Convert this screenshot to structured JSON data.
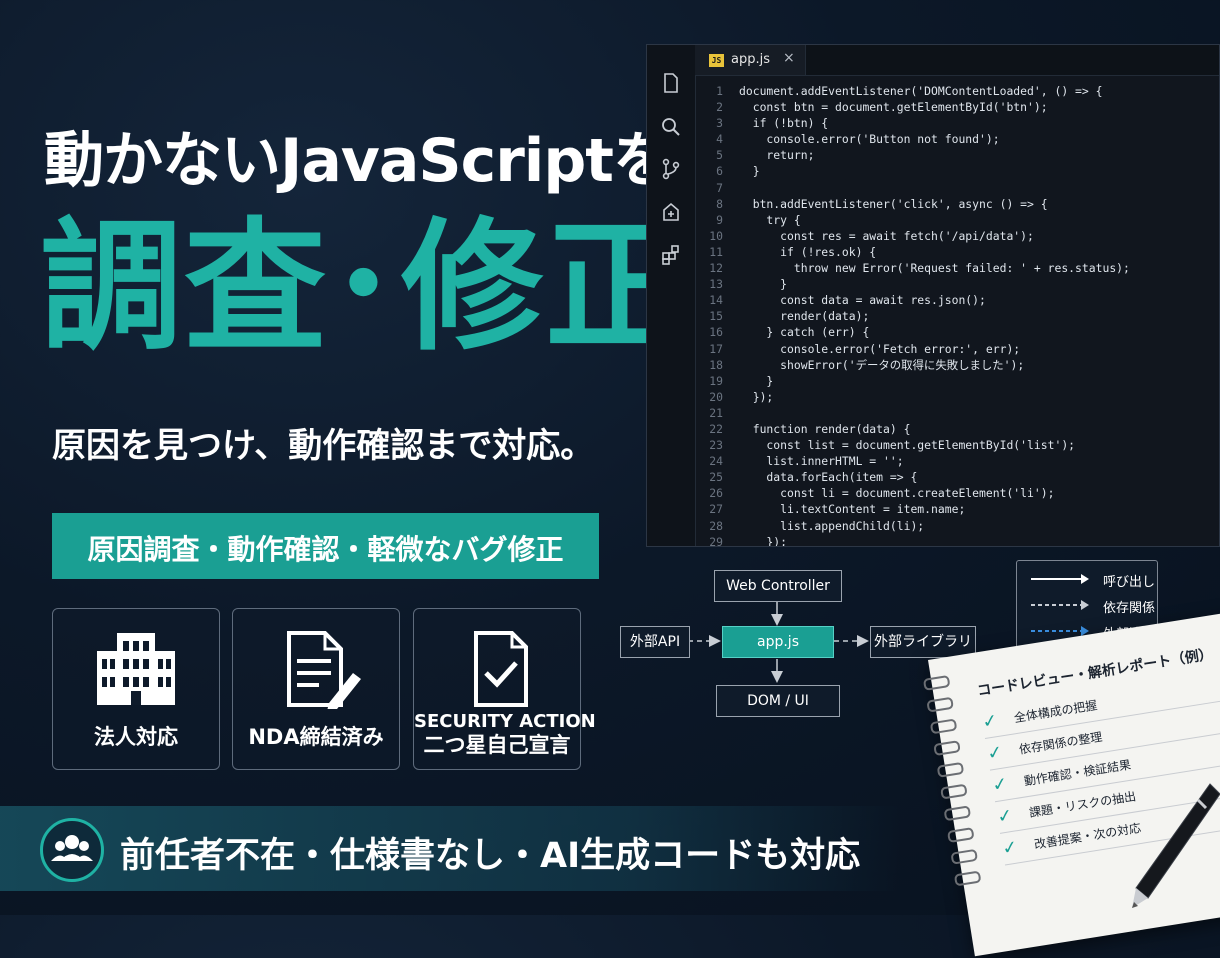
{
  "headline": {
    "line1": "動かないJavaScriptを",
    "main": "調査･修正",
    "subtitle": "原因を見つけ、動作確認まで対応。"
  },
  "banner": "原因調査・動作確認・軽微なバグ修正",
  "badges": [
    {
      "icon": "building-icon",
      "label": "法人対応"
    },
    {
      "icon": "document-pen-icon",
      "label": "NDA締結済み"
    },
    {
      "icon": "clipboard-check-icon",
      "label_top": "SECURITY ACTION",
      "label_bottom": "二つ星自己宣言"
    }
  ],
  "bottom_bar": {
    "icon": "users-icon",
    "text": "前任者不在・仕様書なし・AI生成コードも対応"
  },
  "editor": {
    "tab_badge": "JS",
    "tab_name": "app.js",
    "close_glyph": "×",
    "lines": [
      "document.addEventListener('DOMContentLoaded', () => {",
      "  const btn = document.getElementById('btn');",
      "  if (!btn) {",
      "    console.error('Button not found');",
      "    return;",
      "  }",
      "",
      "  btn.addEventListener('click', async () => {",
      "    try {",
      "      const res = await fetch('/api/data');",
      "      if (!res.ok) {",
      "        throw new Error('Request failed: ' + res.status);",
      "      }",
      "      const data = await res.json();",
      "      render(data);",
      "    } catch (err) {",
      "      console.error('Fetch error:', err);",
      "      showError('データの取得に失敗しました');",
      "    }",
      "  });",
      "",
      "  function render(data) {",
      "    const list = document.getElementById('list');",
      "    list.innerHTML = '';",
      "    data.forEach(item => {",
      "      const li = document.createElement('li');",
      "      li.textContent = item.name;",
      "      list.appendChild(li);",
      "    });"
    ]
  },
  "diagram": {
    "web_controller": "Web Controller",
    "external_api": "外部API",
    "appjs": "app.js",
    "external_library": "外部ライブラリ",
    "dom_ui": "DOM / UI",
    "legend": [
      "呼び出し",
      "依存関係",
      "外部連携"
    ]
  },
  "notepad": {
    "title": "コードレビュー・解析レポート（例）",
    "items": [
      "全体構成の把握",
      "依存関係の整理",
      "動作確認・検証結果",
      "課題・リスクの抽出",
      "改善提案・次の対応"
    ]
  },
  "colors": {
    "accent": "#1fb2a4",
    "banner": "#1a9f93",
    "background": "#0c1828"
  }
}
